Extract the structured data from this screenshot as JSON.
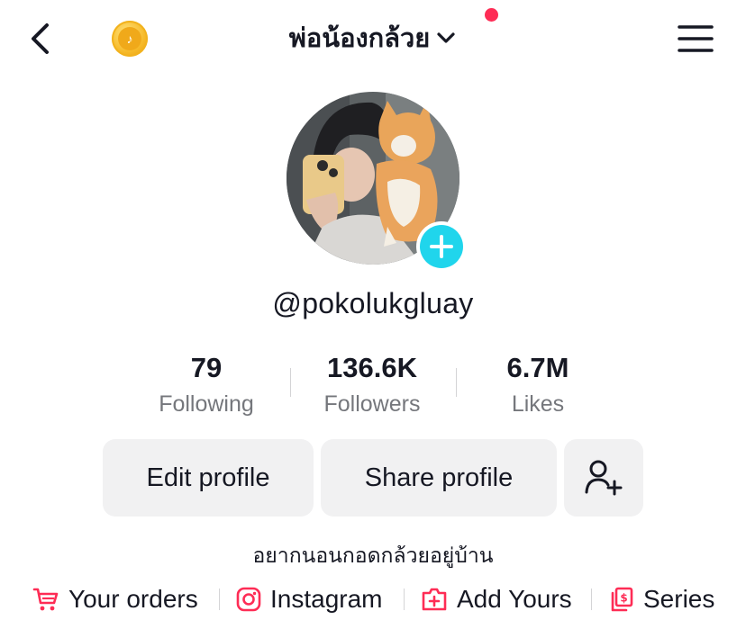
{
  "header": {
    "title": "พ่อน้องกล้วย"
  },
  "profile": {
    "username": "@pokolukgluay",
    "bio": "อยากนอนกอดกล้วยอยู่บ้าน"
  },
  "stats": [
    {
      "value": "79",
      "label": "Following"
    },
    {
      "value": "136.6K",
      "label": "Followers"
    },
    {
      "value": "6.7M",
      "label": "Likes"
    }
  ],
  "buttons": {
    "edit": "Edit profile",
    "share": "Share profile"
  },
  "links": [
    {
      "label": "Your orders",
      "icon": "cart-icon"
    },
    {
      "label": "Instagram",
      "icon": "instagram-icon"
    },
    {
      "label": "Add Yours",
      "icon": "add-yours-icon"
    },
    {
      "label": "Series",
      "icon": "series-icon"
    }
  ],
  "colors": {
    "accent_red": "#fe2c55",
    "plus_cyan": "#20d5ec",
    "button_bg": "#f1f1f2",
    "muted_text": "#75777c",
    "coin_gold": "#f6b928"
  }
}
